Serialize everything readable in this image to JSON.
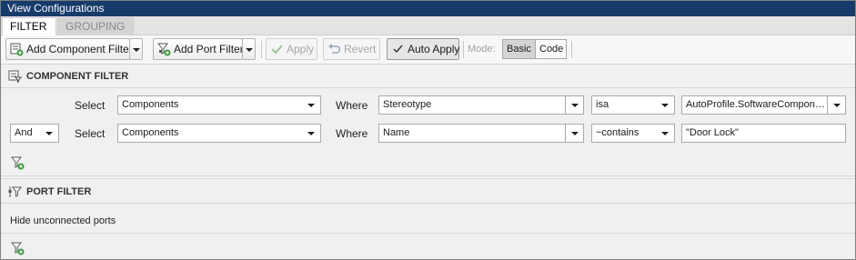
{
  "window": {
    "title": "View Configurations"
  },
  "tabs": [
    {
      "label": "FILTER",
      "active": true
    },
    {
      "label": "GROUPING",
      "active": false
    }
  ],
  "toolbar": {
    "add_component_filter": "Add Component Filter",
    "add_port_filter": "Add Port Filter",
    "apply": "Apply",
    "revert": "Revert",
    "auto_apply": "Auto Apply",
    "auto_apply_checked": true,
    "mode_label": "Mode:",
    "mode_basic": "Basic",
    "mode_code": "Code",
    "mode_selected": "Basic"
  },
  "component_filter": {
    "header": "COMPONENT FILTER",
    "rows": [
      {
        "connector": "",
        "select_label": "Select",
        "select_value": "Components",
        "where_label": "Where",
        "property": "Stereotype",
        "operator": "isa",
        "value": "AutoProfile.SoftwareCompon…",
        "value_is_dropdown": true
      },
      {
        "connector": "And",
        "select_label": "Select",
        "select_value": "Components",
        "where_label": "Where",
        "property": "Name",
        "operator": "~contains",
        "value": "\"Door Lock\"",
        "value_is_dropdown": false
      }
    ]
  },
  "port_filter": {
    "header": "PORT FILTER",
    "rows": [
      {
        "text": "Hide unconnected ports"
      }
    ]
  },
  "colors": {
    "titlebar": "#173b6b",
    "background": "#f0f0f0"
  },
  "icons": {
    "add_component_filter": "add-component-filter-icon",
    "add_port_filter": "add-port-filter-icon",
    "apply": "check-icon",
    "revert": "revert-icon",
    "auto_apply": "checkbox-icon",
    "component_header": "component-filter-icon",
    "port_header": "port-filter-icon",
    "add_row": "add-filter-row-icon"
  }
}
